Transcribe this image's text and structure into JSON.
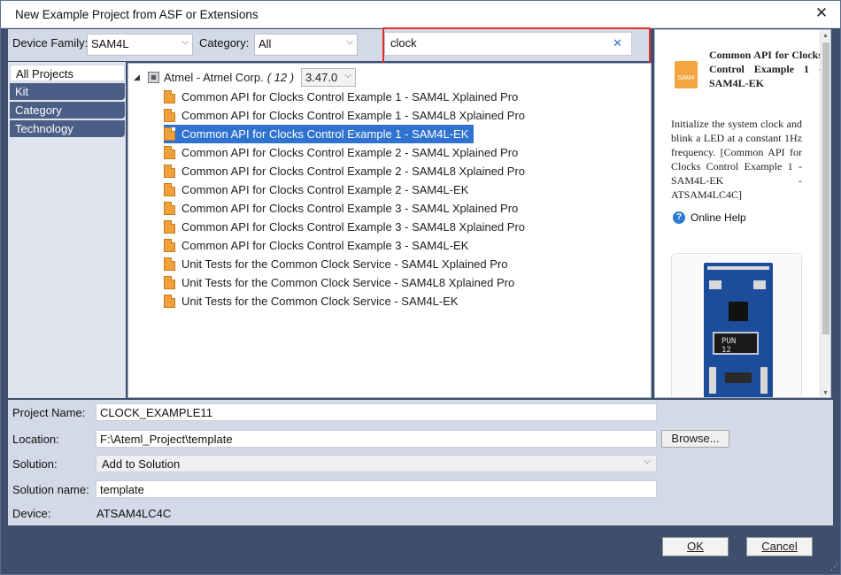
{
  "window": {
    "title": "New Example Project from ASF or Extensions",
    "close_glyph": "✕"
  },
  "filters": {
    "device_family_label": "Device Family:",
    "device_family_value": "SAM4L",
    "category_label": "Category:",
    "category_value": "All",
    "search_value": "clock"
  },
  "categories": [
    {
      "label": "All Projects",
      "active": true
    },
    {
      "label": "Kit",
      "active": false
    },
    {
      "label": "Category",
      "active": false
    },
    {
      "label": "Technology",
      "active": false
    }
  ],
  "tree": {
    "root_label": "Atmel - Atmel Corp.",
    "root_count": "( 12 )",
    "version": "3.47.0",
    "items": [
      {
        "label": "Common API for Clocks Control Example 1 - SAM4L Xplained Pro",
        "selected": false
      },
      {
        "label": "Common API for Clocks Control Example 1 - SAM4L8 Xplained Pro",
        "selected": false
      },
      {
        "label": "Common API for Clocks Control Example 1 - SAM4L-EK",
        "selected": true
      },
      {
        "label": "Common API for Clocks Control Example 2 - SAM4L Xplained Pro",
        "selected": false
      },
      {
        "label": "Common API for Clocks Control Example 2 - SAM4L8 Xplained Pro",
        "selected": false
      },
      {
        "label": "Common API for Clocks Control Example 2 - SAM4L-EK",
        "selected": false
      },
      {
        "label": "Common API for Clocks Control Example 3 - SAM4L Xplained Pro",
        "selected": false
      },
      {
        "label": "Common API for Clocks Control Example 3 - SAM4L8 Xplained Pro",
        "selected": false
      },
      {
        "label": "Common API for Clocks Control Example 3 - SAM4L-EK",
        "selected": false
      },
      {
        "label": "Unit Tests for the Common Clock Service - SAM4L Xplained Pro",
        "selected": false
      },
      {
        "label": "Unit Tests for the Common Clock Service - SAM4L8 Xplained Pro",
        "selected": false
      },
      {
        "label": "Unit Tests for the Common Clock Service - SAM4L-EK",
        "selected": false
      }
    ]
  },
  "info": {
    "icon_caption": "SAM4",
    "title": "Common API for Clocks Control Example 1 - SAM4L-EK",
    "description": "Initialize the system clock and blink a LED at a constant 1Hz frequency. [Common API for Clocks Control Example 1 - SAM4L-EK - ATSAM4LC4C]",
    "online_help": "Online Help",
    "board_lcd_text": "PUN 12"
  },
  "form": {
    "project_name_label": "Project Name:",
    "project_name_value": "CLOCK_EXAMPLE11",
    "location_label": "Location:",
    "location_value": "F:\\Ateml_Project\\template",
    "browse_label": "Browse...",
    "solution_label": "Solution:",
    "solution_value": "Add to Solution",
    "solution_name_label": "Solution name:",
    "solution_name_value": "template",
    "device_label": "Device:",
    "device_value": "ATSAM4LC4C"
  },
  "buttons": {
    "ok": "OK",
    "cancel": "Cancel"
  },
  "colors": {
    "selection": "#3072d0",
    "category_tab": "#4b5f86",
    "highlight_box": "#e0302c",
    "dialog_footer": "#3e4e6d"
  }
}
